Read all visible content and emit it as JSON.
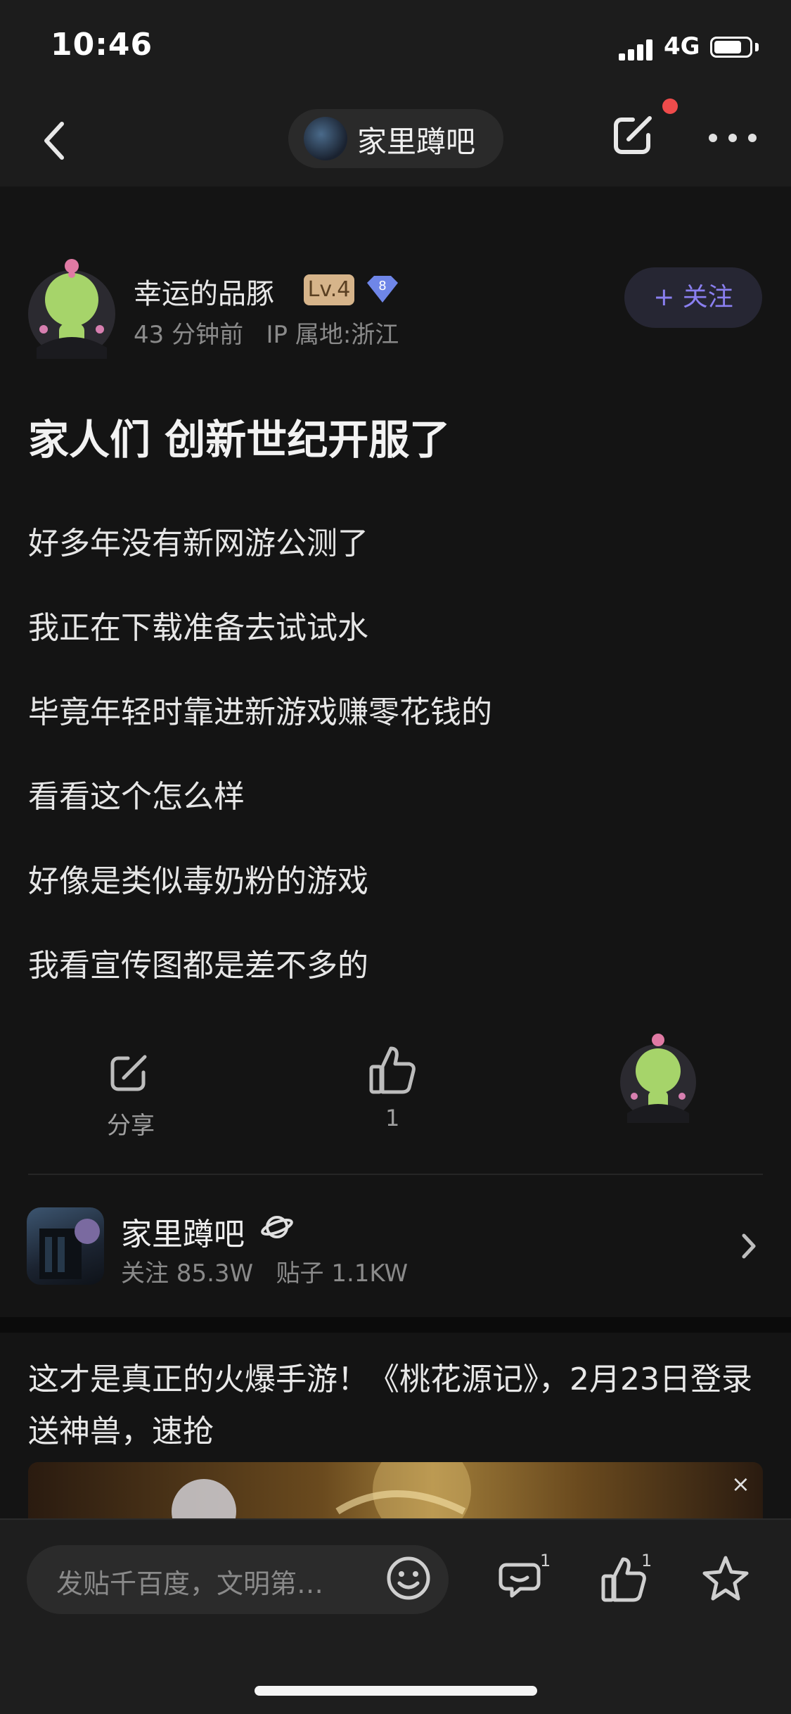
{
  "status_bar": {
    "time": "10:46",
    "network": "4G",
    "battery_level": 0.8
  },
  "nav": {
    "forum_name": "家里蹲吧",
    "back_icon": "chevron-left-icon",
    "edit_icon": "share-edit-icon",
    "more_icon": "more-dots-icon",
    "notification_dot_color": "#ef4b4b"
  },
  "post": {
    "author": {
      "name": "幸运的品豚",
      "level": "Lv.4",
      "gem_level": "8"
    },
    "meta": "43 分钟前   IP 属地:浙江",
    "follow_label": "+ 关注",
    "title": "家人们 创新世纪开服了",
    "lines": [
      "好多年没有新网游公测了",
      "我正在下载准备去试试水",
      "毕竟年轻时靠进新游戏赚零花钱的",
      "看看这个怎么样",
      "好像是类似毒奶粉的游戏",
      "我看宣传图都是差不多的"
    ]
  },
  "actions": {
    "share_label": "分享",
    "like_count": "1"
  },
  "forum_card": {
    "name": "家里蹲吧",
    "stats": "关注 85.3W   贴子 1.1KW"
  },
  "ad": {
    "title": "这才是真正的火爆手游！《桃花源记》，2月23日登录送神兽，速抢",
    "close_label": "×"
  },
  "bottom_bar": {
    "input_placeholder": "发贴千百度，文明第…",
    "comment_badge": "1",
    "like_badge": "1",
    "icons": [
      "emoji-icon",
      "comment-icon",
      "thumbs-up-icon",
      "star-icon"
    ]
  },
  "colors": {
    "background": "#141414",
    "accent_purple": "#8a7ff0",
    "level_badge": "#d6b48a"
  }
}
